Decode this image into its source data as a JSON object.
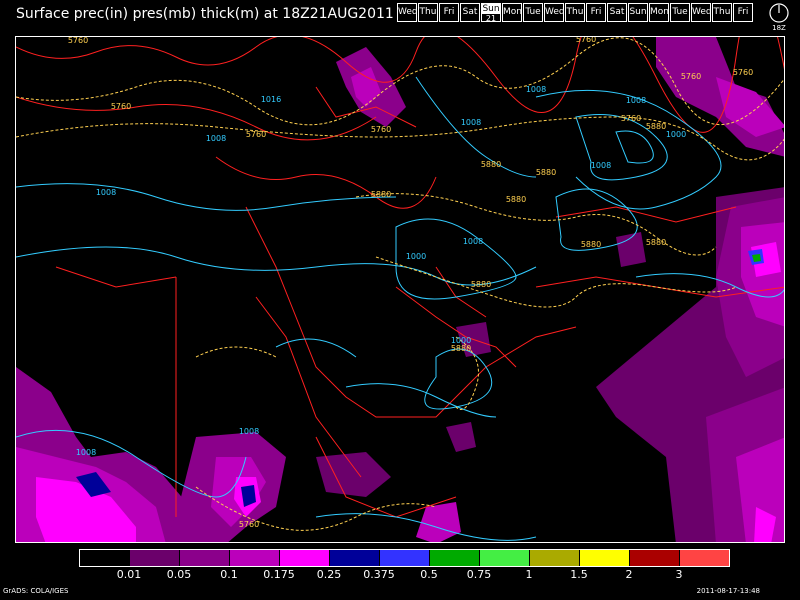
{
  "title": "Surface prec(in) pres(mb) thick(m) at 18Z21AUG2011",
  "day_strip": [
    {
      "label": "Wed"
    },
    {
      "label": "Thu"
    },
    {
      "label": "Fri"
    },
    {
      "label": "Sat"
    },
    {
      "label": "Sun",
      "selected": true,
      "date": "21"
    },
    {
      "label": "Mon"
    },
    {
      "label": "Tue"
    },
    {
      "label": "Wed"
    },
    {
      "label": "Thu"
    },
    {
      "label": "Fri"
    },
    {
      "label": "Sat"
    },
    {
      "label": "Sun"
    },
    {
      "label": "Mon"
    },
    {
      "label": "Tue"
    },
    {
      "label": "Wed"
    },
    {
      "label": "Thu"
    },
    {
      "label": "Fri"
    }
  ],
  "clock": {
    "icon": "clock-icon",
    "label": "18Z"
  },
  "map": {
    "pressure_labels": [
      "1008",
      "1008",
      "1016",
      "1008",
      "1008",
      "1008",
      "1008",
      "1008",
      "1000",
      "1000",
      "1000",
      "1008",
      "1008"
    ],
    "thickness_labels": [
      "5760",
      "5760",
      "5760",
      "5760",
      "5760",
      "5760",
      "5880",
      "5880",
      "5880",
      "5880",
      "5880",
      "5880",
      "5880",
      "5880",
      "5880",
      "5760",
      "5760",
      "5760"
    ]
  },
  "legend": {
    "colors": [
      "#000000",
      "#6b006b",
      "#8b008b",
      "#bb00bb",
      "#ff00ff",
      "#000099",
      "#3333ff",
      "#00aa00",
      "#44ee44",
      "#aaaa00",
      "#ffff00",
      "#aa0000",
      "#ff4444"
    ],
    "labels": [
      "0.01",
      "0.05",
      "0.1",
      "0.175",
      "0.25",
      "0.375",
      "0.5",
      "0.75",
      "1",
      "1.5",
      "2",
      "3"
    ]
  },
  "footer": {
    "left": "GrADS: COLA/IGES",
    "right": "2011-08-17-13:48"
  }
}
